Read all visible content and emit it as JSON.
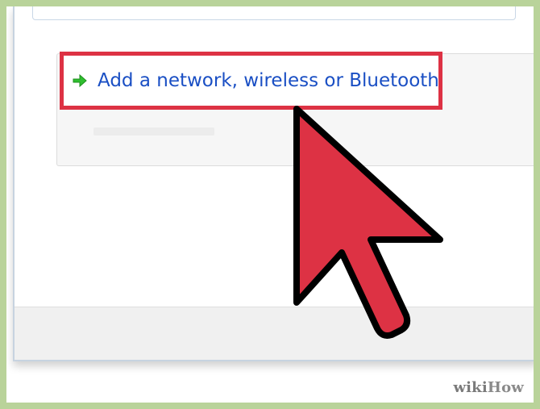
{
  "window": {
    "link": {
      "label": "Add a network, wireless or Bluetooth",
      "icon": "green-arrow-icon"
    }
  },
  "overlay": {
    "cursor_icon": "red-pointer-icon",
    "highlight_color": "#dd3244",
    "cursor_color": "#dd3244"
  },
  "watermark": {
    "part1": "wiki",
    "part2": "How"
  },
  "colors": {
    "frame_border": "#b9d39a",
    "link_color": "#1a4fc4",
    "arrow_green": "#2fbf2f"
  }
}
